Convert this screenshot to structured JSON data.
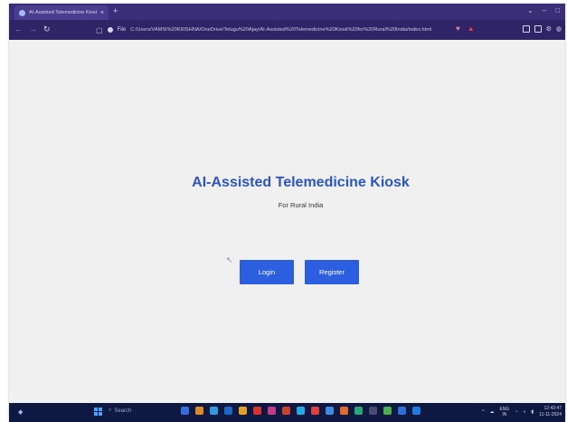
{
  "browser": {
    "tab_title": "AI-Assisted Telemedicine Kiosk",
    "tab_close": "×",
    "new_tab": "+",
    "window_controls": [
      "⌄",
      "–",
      "□"
    ],
    "file_label": "File",
    "url": "C:/Users/VAMSI%20KRISHNA/OneDrive/Telugu%20Ajay/AI-Assisted%20Telemedicine%20Kiosk%20for%20Rural%20India/index.html"
  },
  "page": {
    "title": "AI-Assisted Telemedicine Kiosk",
    "subtitle": "For Rural India",
    "login_label": "Login",
    "register_label": "Register"
  },
  "taskbar": {
    "search_placeholder": "Search",
    "lang_top": "ENG",
    "lang_bottom": "IN",
    "time": "12:43:47",
    "date": "11-11-2024"
  },
  "colors": {
    "accent": "#2b5fe0",
    "title": "#2d55c0",
    "browser_chrome": "#2e2466",
    "taskbar": "#0f1840"
  }
}
